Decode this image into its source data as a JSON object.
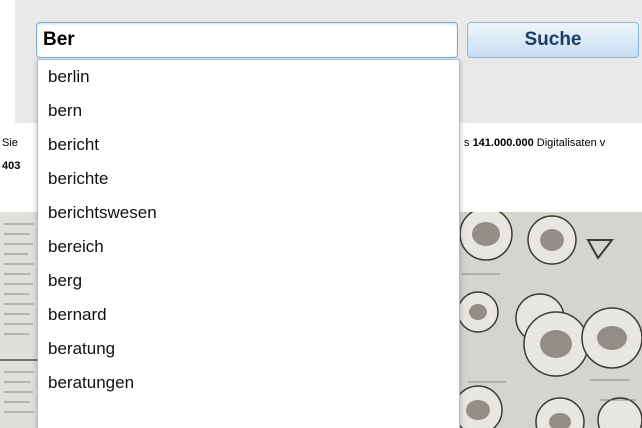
{
  "search": {
    "value": "Ber",
    "button_label": "Suche"
  },
  "info": {
    "prefix": "Sie",
    "count_prefix": "403",
    "suffix_number": "141.000.000",
    "suffix_text": " Digitalisaten v"
  },
  "suggestions": [
    "berlin",
    "bern",
    "bericht",
    "berichte",
    "berichtswesen",
    "bereich",
    "berg",
    "bernard",
    "beratung",
    "beratungen"
  ],
  "colors": {
    "band": "#e9e9e9",
    "input_border": "#7aaed8",
    "button_text": "#1b3c63"
  }
}
